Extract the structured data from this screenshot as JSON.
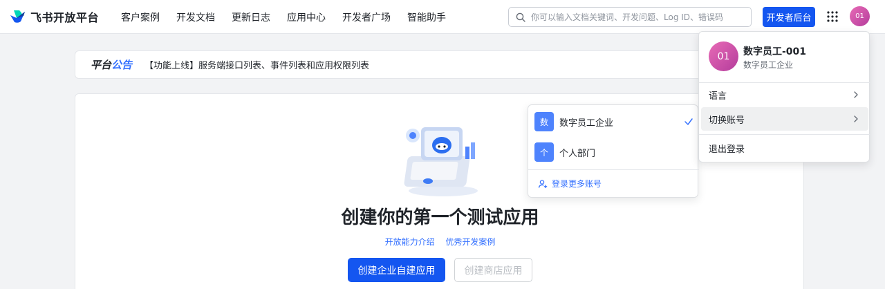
{
  "brand": {
    "name": "飞书开放平台",
    "logo_icon": "feishu-logo-icon"
  },
  "nav": {
    "links": [
      "客户案例",
      "开发文档",
      "更新日志",
      "应用中心",
      "开发者广场",
      "智能助手"
    ]
  },
  "search": {
    "placeholder": "你可以输入文档关键词、开发问题、Log ID、错误码"
  },
  "header": {
    "console_label": "开发者后台",
    "avatar_text": "01"
  },
  "announcement": {
    "title_part1": "平台",
    "title_part2": "公告",
    "text": "【功能上线】服务端接口列表、事件列表和应用权限列表"
  },
  "main": {
    "heading": "创建你的第一个测试应用",
    "links": [
      "开放能力介绍",
      "优秀开发案例"
    ],
    "primary_button": "创建企业自建应用",
    "disabled_button": "创建商店应用"
  },
  "account_menu": {
    "items": [
      {
        "icon_text": "数",
        "label": "数字员工企业",
        "selected": true,
        "color": "#4e83fd"
      },
      {
        "icon_text": "个",
        "label": "个人部门",
        "selected": false,
        "color": "#4e83fd"
      }
    ],
    "login_more": "登录更多账号"
  },
  "profile_menu": {
    "avatar_text": "01",
    "name": "数字员工-001",
    "org": "数字员工企业",
    "items": [
      "语言",
      "切换账号",
      "退出登录"
    ]
  },
  "colors": {
    "accent": "#1456f0",
    "link": "#3370ff",
    "avatar": "#c94fa8"
  }
}
